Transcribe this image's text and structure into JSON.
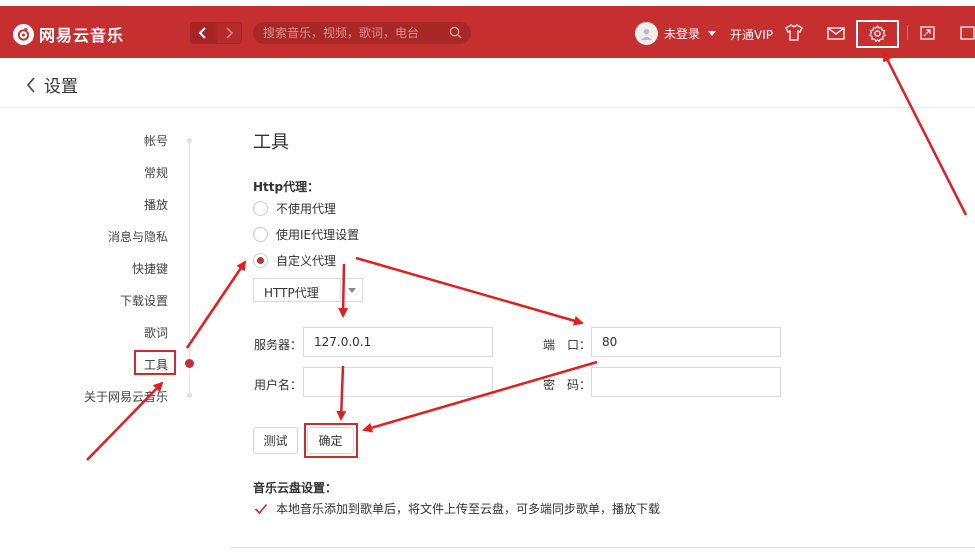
{
  "app": {
    "name": "网易云音乐",
    "accent": "#c62f2f"
  },
  "header": {
    "search_placeholder": "搜索音乐，视频，歌词，电台",
    "user_label": "未登录",
    "vip_label": "开通VIP",
    "icons": [
      "shirt-icon",
      "mail-icon",
      "gear-icon",
      "mini-mode-icon",
      "window-icon"
    ]
  },
  "page": {
    "title": "设置"
  },
  "sidebar": {
    "items": [
      {
        "label": "帐号"
      },
      {
        "label": "常规"
      },
      {
        "label": "播放"
      },
      {
        "label": "消息与隐私"
      },
      {
        "label": "快捷键"
      },
      {
        "label": "下载设置"
      },
      {
        "label": "歌词"
      },
      {
        "label": "工具",
        "active": true
      },
      {
        "label": "关于网易云音乐"
      }
    ]
  },
  "tools": {
    "title": "工具",
    "proxy_label": "Http代理：",
    "options": [
      {
        "label": "不使用代理",
        "selected": false
      },
      {
        "label": "使用IE代理设置",
        "selected": false
      },
      {
        "label": "自定义代理",
        "selected": true
      }
    ],
    "proxy_type": "HTTP代理",
    "server_label": "服务器：",
    "server_value": "127.0.0.1",
    "port_label": "端　口：",
    "port_value": "80",
    "username_label": "用户名：",
    "username_value": "",
    "password_label": "密　码：",
    "password_value": "",
    "test_button": "测试",
    "confirm_button": "确定",
    "cloud_label": "音乐云盘设置：",
    "cloud_option": "本地音乐添加到歌单后，将文件上传至云盘，可多端同步歌单，播放下载",
    "cloud_checked": true
  },
  "annotation_color": "#e02020"
}
